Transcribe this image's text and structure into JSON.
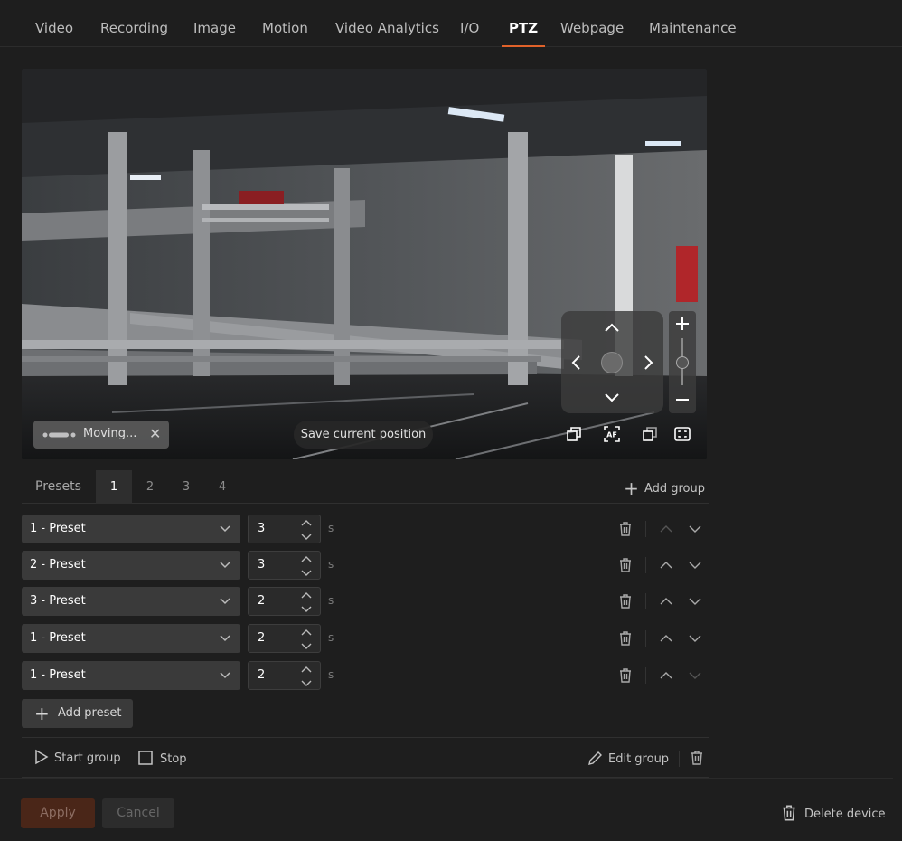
{
  "nav": {
    "tabs": [
      "Video",
      "Recording",
      "Image",
      "Motion",
      "Video Analytics",
      "I/O",
      "PTZ",
      "Webpage",
      "Maintenance"
    ],
    "active": "PTZ"
  },
  "video": {
    "status_text": "Moving...",
    "save_position_label": "Save current position"
  },
  "presets": {
    "label": "Presets",
    "group_tabs": [
      "1",
      "2",
      "3",
      "4"
    ],
    "active_group": "1",
    "add_group_label": "Add group",
    "rows": [
      {
        "preset": "1 - Preset",
        "duration": "3",
        "unit": "s"
      },
      {
        "preset": "2 - Preset",
        "duration": "3",
        "unit": "s"
      },
      {
        "preset": "3 - Preset",
        "duration": "2",
        "unit": "s"
      },
      {
        "preset": "1 - Preset",
        "duration": "2",
        "unit": "s"
      },
      {
        "preset": "1 - Preset",
        "duration": "2",
        "unit": "s"
      }
    ],
    "add_preset_label": "Add preset"
  },
  "group_actions": {
    "start_label": "Start group",
    "stop_label": "Stop",
    "edit_label": "Edit group"
  },
  "footer": {
    "apply_label": "Apply",
    "cancel_label": "Cancel",
    "delete_device_label": "Delete device"
  },
  "colors": {
    "accent": "#e0622a",
    "background": "#1e1e1e",
    "control_bg": "#3a3a3a"
  }
}
